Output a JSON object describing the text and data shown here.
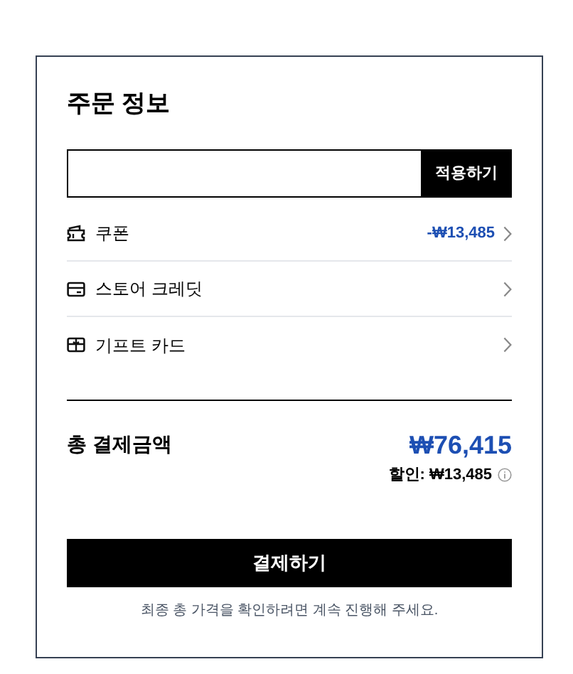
{
  "title": "주문 정보",
  "code_field": {
    "button": "적용하기"
  },
  "options": [
    {
      "kind": "coupon",
      "label": "쿠폰",
      "value": "-₩13,485"
    },
    {
      "kind": "card",
      "label": "스토어 크레딧"
    },
    {
      "kind": "gift",
      "label": "기프트 카드"
    }
  ],
  "total": {
    "label": "총 결제금액",
    "amount": "₩76,415",
    "discount": "할인: ₩13,485"
  },
  "pay_button": "결제하기",
  "note": "최종 총 가격을 확인하려면 계속 진행해 주세요."
}
